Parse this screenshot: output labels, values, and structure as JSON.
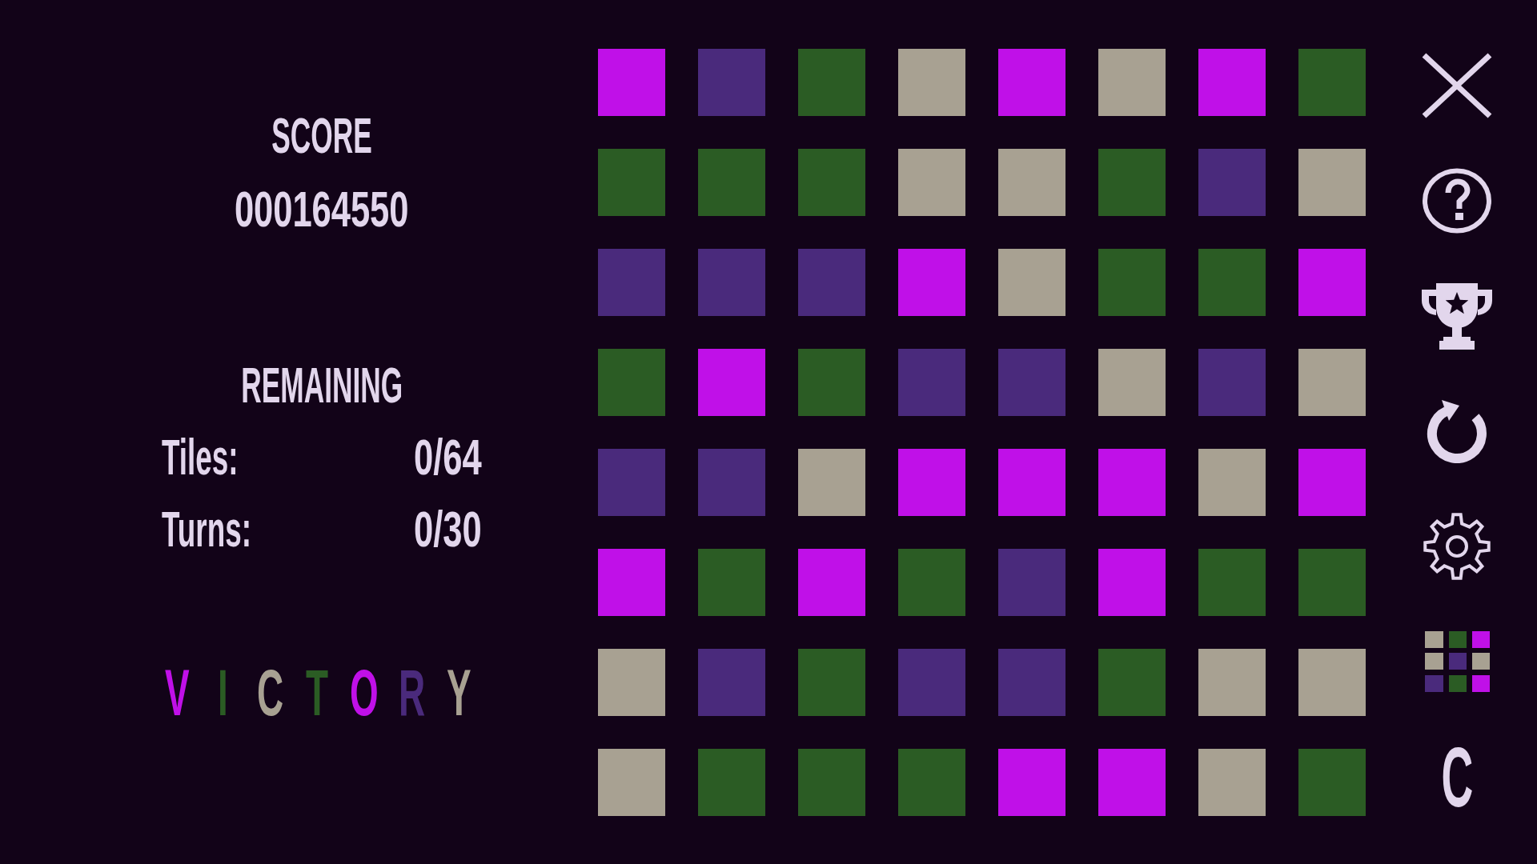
{
  "score": {
    "label": "SCORE",
    "value": "000164550"
  },
  "remaining": {
    "label": "REMAINING",
    "rows": [
      {
        "label": "Tiles:",
        "value": "0/64"
      },
      {
        "label": "Turns:",
        "value": "0/30"
      }
    ]
  },
  "victory": {
    "letters": [
      {
        "char": "V",
        "color": "#c010e8"
      },
      {
        "char": "I",
        "color": "#2b5c24"
      },
      {
        "char": "C",
        "color": "#a8a192"
      },
      {
        "char": "T",
        "color": "#2b5c24"
      },
      {
        "char": "O",
        "color": "#c010e8"
      },
      {
        "char": "R",
        "color": "#4a2a7c"
      },
      {
        "char": "Y",
        "color": "#a8a192"
      }
    ]
  },
  "board": {
    "rows": [
      {
        "tiles": [
          {
            "color": "#c010e8"
          },
          {
            "color": "#4a2a7c"
          },
          {
            "color": "#2b5c24"
          },
          {
            "color": "#a8a192"
          },
          {
            "color": "#c010e8"
          },
          {
            "color": "#a8a192"
          },
          {
            "color": "#c010e8"
          },
          {
            "color": "#2b5c24"
          }
        ]
      },
      {
        "tiles": [
          {
            "color": "#2b5c24"
          },
          {
            "color": "#2b5c24"
          },
          {
            "color": "#2b5c24"
          },
          {
            "color": "#a8a192"
          },
          {
            "color": "#a8a192"
          },
          {
            "color": "#2b5c24"
          },
          {
            "color": "#4a2a7c"
          },
          {
            "color": "#a8a192"
          }
        ]
      },
      {
        "tiles": [
          {
            "color": "#4a2a7c"
          },
          {
            "color": "#4a2a7c"
          },
          {
            "color": "#4a2a7c"
          },
          {
            "color": "#c010e8"
          },
          {
            "color": "#a8a192"
          },
          {
            "color": "#2b5c24"
          },
          {
            "color": "#2b5c24"
          },
          {
            "color": "#c010e8"
          }
        ]
      },
      {
        "tiles": [
          {
            "color": "#2b5c24"
          },
          {
            "color": "#c010e8"
          },
          {
            "color": "#2b5c24"
          },
          {
            "color": "#4a2a7c"
          },
          {
            "color": "#4a2a7c"
          },
          {
            "color": "#a8a192"
          },
          {
            "color": "#4a2a7c"
          },
          {
            "color": "#a8a192"
          }
        ]
      },
      {
        "tiles": [
          {
            "color": "#4a2a7c"
          },
          {
            "color": "#4a2a7c"
          },
          {
            "color": "#a8a192"
          },
          {
            "color": "#c010e8"
          },
          {
            "color": "#c010e8"
          },
          {
            "color": "#c010e8"
          },
          {
            "color": "#a8a192"
          },
          {
            "color": "#c010e8"
          }
        ]
      },
      {
        "tiles": [
          {
            "color": "#c010e8"
          },
          {
            "color": "#2b5c24"
          },
          {
            "color": "#c010e8"
          },
          {
            "color": "#2b5c24"
          },
          {
            "color": "#4a2a7c"
          },
          {
            "color": "#c010e8"
          },
          {
            "color": "#2b5c24"
          },
          {
            "color": "#2b5c24"
          }
        ]
      },
      {
        "tiles": [
          {
            "color": "#a8a192"
          },
          {
            "color": "#4a2a7c"
          },
          {
            "color": "#2b5c24"
          },
          {
            "color": "#4a2a7c"
          },
          {
            "color": "#4a2a7c"
          },
          {
            "color": "#2b5c24"
          },
          {
            "color": "#a8a192"
          },
          {
            "color": "#a8a192"
          }
        ]
      },
      {
        "tiles": [
          {
            "color": "#a8a192"
          },
          {
            "color": "#2b5c24"
          },
          {
            "color": "#2b5c24"
          },
          {
            "color": "#2b5c24"
          },
          {
            "color": "#c010e8"
          },
          {
            "color": "#c010e8"
          },
          {
            "color": "#a8a192"
          },
          {
            "color": "#2b5c24"
          }
        ]
      }
    ]
  },
  "toolbar": {
    "buttons": [
      {
        "kind": "close"
      },
      {
        "kind": "help"
      },
      {
        "kind": "trophy"
      },
      {
        "kind": "restart"
      },
      {
        "kind": "settings"
      },
      {
        "kind": "tiles"
      },
      {
        "kind": "text",
        "label": "C"
      }
    ]
  }
}
